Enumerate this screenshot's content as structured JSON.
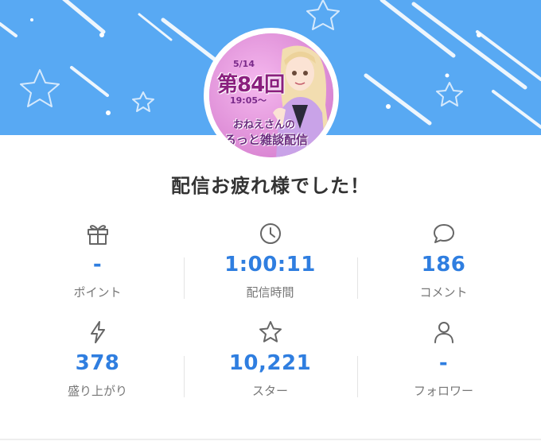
{
  "heading": "配信お疲れ様でした！",
  "thumbnail": {
    "date": "5/14",
    "episode": "第84回",
    "time": "19:05〜",
    "line1": "おねえさんの",
    "line2": "ゆるっと雑談配信"
  },
  "stats": [
    {
      "icon": "gift-icon",
      "value": "-",
      "label": "ポイント"
    },
    {
      "icon": "clock-icon",
      "value": "1:00:11",
      "label": "配信時間"
    },
    {
      "icon": "comment-icon",
      "value": "186",
      "label": "コメント"
    },
    {
      "icon": "lightning-icon",
      "value": "378",
      "label": "盛り上がり"
    },
    {
      "icon": "star-icon",
      "value": "10,221",
      "label": "スター"
    },
    {
      "icon": "person-icon",
      "value": "-",
      "label": "フォロワー"
    }
  ],
  "colors": {
    "banner": "#58a9f3",
    "value": "#2f7ee0",
    "label": "#777777",
    "icon": "#666666"
  }
}
